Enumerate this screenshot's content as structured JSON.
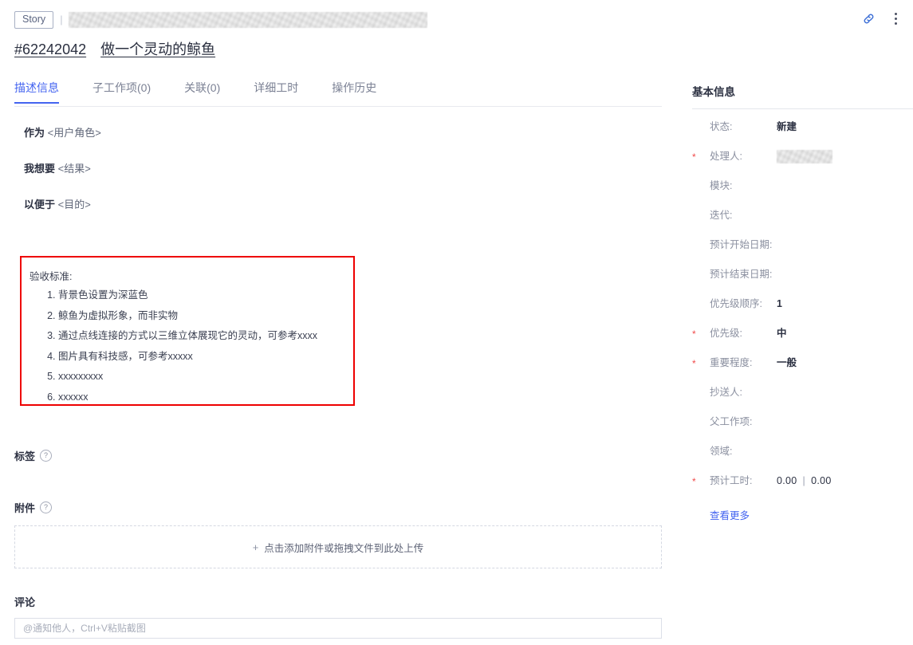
{
  "topbar": {
    "type_badge": "Story",
    "separator": "|",
    "redacted_title_label": "redacted-project-name",
    "link_icon": "link-icon",
    "menu_icon": "kebab-menu-icon"
  },
  "header": {
    "issue_id": "#62242042",
    "issue_title": "做一个灵动的鲸鱼"
  },
  "tabs": [
    {
      "label": "描述信息",
      "active": true
    },
    {
      "label": "子工作项(0)",
      "active": false
    },
    {
      "label": "关联(0)",
      "active": false
    },
    {
      "label": "详细工时",
      "active": false
    },
    {
      "label": "操作历史",
      "active": false
    }
  ],
  "description": {
    "lines": [
      {
        "label": "作为",
        "placeholder": "<用户角色>"
      },
      {
        "label": "我想要",
        "placeholder": "<结果>"
      },
      {
        "label": "以便于",
        "placeholder": "<目的>"
      }
    ],
    "criteria": {
      "heading": "验收标准:",
      "items": [
        "背景色设置为深蓝色",
        "鲸鱼为虚拟形象，而非实物",
        "通过点线连接的方式以三维立体展现它的灵动，可参考xxxx",
        "图片具有科技感，可参考xxxxx",
        "xxxxxxxxx",
        "xxxxxx"
      ],
      "border_color": "#ee0000"
    }
  },
  "tags": {
    "heading": "标签",
    "help_icon": "help-circle-icon",
    "help_glyph": "?"
  },
  "attachments": {
    "heading": "附件",
    "help_icon": "help-circle-icon",
    "help_glyph": "?",
    "dropzone_plus": "+",
    "dropzone_text": "点击添加附件或拖拽文件到此处上传"
  },
  "comment": {
    "heading": "评论",
    "placeholder": "@通知他人，Ctrl+V粘贴截图",
    "value": ""
  },
  "sidebar": {
    "title": "基本信息",
    "fields": [
      {
        "label": "状态:",
        "value": "新建",
        "required": false,
        "bold": true,
        "redacted": false
      },
      {
        "label": "处理人:",
        "value": "",
        "required": true,
        "bold": false,
        "redacted": true
      },
      {
        "label": "模块:",
        "value": "",
        "required": false,
        "bold": false,
        "redacted": false
      },
      {
        "label": "迭代:",
        "value": "",
        "required": false,
        "bold": false,
        "redacted": false
      },
      {
        "label": "预计开始日期:",
        "value": "",
        "required": false,
        "bold": false,
        "redacted": false
      },
      {
        "label": "预计结束日期:",
        "value": "",
        "required": false,
        "bold": false,
        "redacted": false
      },
      {
        "label": "优先级顺序:",
        "value": "1",
        "required": false,
        "bold": true,
        "redacted": false
      },
      {
        "label": "优先级:",
        "value": "中",
        "required": true,
        "bold": true,
        "redacted": false
      },
      {
        "label": "重要程度:",
        "value": "一般",
        "required": true,
        "bold": true,
        "redacted": false
      },
      {
        "label": "抄送人:",
        "value": "",
        "required": false,
        "bold": false,
        "redacted": false
      },
      {
        "label": "父工作项:",
        "value": "",
        "required": false,
        "bold": false,
        "redacted": false
      },
      {
        "label": "领域:",
        "value": "",
        "required": false,
        "bold": false,
        "redacted": false
      }
    ],
    "hours_field": {
      "label": "预计工时:",
      "required": true,
      "first": "0.00",
      "separator": "|",
      "second": "0.00"
    },
    "more_link": "查看更多",
    "required_marker": "*"
  },
  "colors": {
    "accent": "#4464f0",
    "required": "#f04a4a",
    "criteria_border": "#ee0000",
    "text": "#2c3142",
    "muted": "#8b90a0"
  }
}
